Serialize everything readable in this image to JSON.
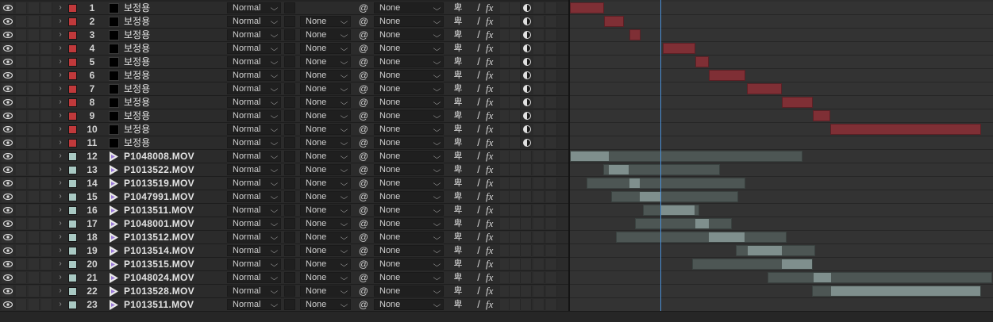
{
  "mode_chevron": "⌵",
  "colors": {
    "solid_label": "#c0393b",
    "video_label": "#a9c9c3",
    "solid_bar": "#7f2f35",
    "video_bar": "#4d5654",
    "video_bar_work": "#7f8f8d",
    "time_indicator": "#4a8fd6"
  },
  "icons": {
    "visibility": "eye-icon",
    "twirl": "chevron-right-icon",
    "parent_pick": "spiral-icon",
    "shy": "shy-icon",
    "quality": "slash-icon",
    "effects": "fx-icon",
    "adjustment": "adjustment-layer-icon",
    "footage": "footage-icon"
  },
  "layers": [
    {
      "index": "1",
      "name": "보정용",
      "kind": "solid",
      "mode": "Normal",
      "track_matte": "",
      "parent": "None",
      "quality": "/",
      "fx": "fx",
      "shy": "卑",
      "bar_start": 0.0,
      "bar_end": 0.08
    },
    {
      "index": "2",
      "name": "보정용",
      "kind": "solid",
      "mode": "Normal",
      "track_matte": "None",
      "parent": "None",
      "quality": "/",
      "fx": "fx",
      "shy": "卑",
      "bar_start": 0.08,
      "bar_end": 0.127
    },
    {
      "index": "3",
      "name": "보정용",
      "kind": "solid",
      "mode": "Normal",
      "track_matte": "None",
      "parent": "None",
      "quality": "/",
      "fx": "fx",
      "shy": "卑",
      "bar_start": 0.141,
      "bar_end": 0.167
    },
    {
      "index": "4",
      "name": "보정용",
      "kind": "solid",
      "mode": "Normal",
      "track_matte": "None",
      "parent": "None",
      "quality": "/",
      "fx": "fx",
      "shy": "卑",
      "bar_start": 0.22,
      "bar_end": 0.297
    },
    {
      "index": "5",
      "name": "보정용",
      "kind": "solid",
      "mode": "Normal",
      "track_matte": "None",
      "parent": "None",
      "quality": "/",
      "fx": "fx",
      "shy": "卑",
      "bar_start": 0.297,
      "bar_end": 0.329
    },
    {
      "index": "6",
      "name": "보정용",
      "kind": "solid",
      "mode": "Normal",
      "track_matte": "None",
      "parent": "None",
      "quality": "/",
      "fx": "fx",
      "shy": "卑",
      "bar_start": 0.329,
      "bar_end": 0.414
    },
    {
      "index": "7",
      "name": "보정용",
      "kind": "solid",
      "mode": "Normal",
      "track_matte": "None",
      "parent": "None",
      "quality": "/",
      "fx": "fx",
      "shy": "卑",
      "bar_start": 0.418,
      "bar_end": 0.501
    },
    {
      "index": "8",
      "name": "보정용",
      "kind": "solid",
      "mode": "Normal",
      "track_matte": "None",
      "parent": "None",
      "quality": "/",
      "fx": "fx",
      "shy": "卑",
      "bar_start": 0.501,
      "bar_end": 0.574
    },
    {
      "index": "9",
      "name": "보정용",
      "kind": "solid",
      "mode": "Normal",
      "track_matte": "None",
      "parent": "None",
      "quality": "/",
      "fx": "fx",
      "shy": "卑",
      "bar_start": 0.574,
      "bar_end": 0.616
    },
    {
      "index": "10",
      "name": "보정용",
      "kind": "solid",
      "mode": "Normal",
      "track_matte": "None",
      "parent": "None",
      "quality": "/",
      "fx": "fx",
      "shy": "卑",
      "bar_start": 0.616,
      "bar_end": 0.972
    },
    {
      "index": "11",
      "name": "보정용",
      "kind": "solid",
      "mode": "Normal",
      "track_matte": "None",
      "parent": "None",
      "quality": "/",
      "fx": "fx",
      "shy": "卑",
      "bar_start": null,
      "bar_end": null
    },
    {
      "index": "12",
      "name": "P1048008.MOV",
      "kind": "video",
      "mode": "Normal",
      "track_matte": "None",
      "parent": "None",
      "quality": "/",
      "fx": "fx",
      "shy": "卑",
      "bar_start": 0.0,
      "bar_end": 0.55,
      "work_start": 0.0,
      "work_end": 0.09
    },
    {
      "index": "13",
      "name": "P1013522.MOV",
      "kind": "video",
      "mode": "Normal",
      "track_matte": "None",
      "parent": "None",
      "quality": "/",
      "fx": "fx",
      "shy": "卑",
      "bar_start": 0.079,
      "bar_end": 0.355,
      "work_start": 0.09,
      "work_end": 0.137
    },
    {
      "index": "14",
      "name": "P1013519.MOV",
      "kind": "video",
      "mode": "Normal",
      "track_matte": "None",
      "parent": "None",
      "quality": "/",
      "fx": "fx",
      "shy": "卑",
      "bar_start": 0.04,
      "bar_end": 0.414,
      "work_start": 0.139,
      "work_end": 0.165
    },
    {
      "index": "15",
      "name": "P1047991.MOV",
      "kind": "video",
      "mode": "Normal",
      "track_matte": "None",
      "parent": "None",
      "quality": "/",
      "fx": "fx",
      "shy": "卑",
      "bar_start": 0.098,
      "bar_end": 0.398,
      "work_start": 0.165,
      "work_end": 0.214
    },
    {
      "index": "16",
      "name": "P1013511.MOV",
      "kind": "video",
      "mode": "Normal",
      "track_matte": "None",
      "parent": "None",
      "quality": "/",
      "fx": "fx",
      "shy": "卑",
      "bar_start": 0.173,
      "bar_end": 0.306,
      "work_start": 0.216,
      "work_end": 0.297
    },
    {
      "index": "17",
      "name": "P1048001.MOV",
      "kind": "video",
      "mode": "Normal",
      "track_matte": "None",
      "parent": "None",
      "quality": "/",
      "fx": "fx",
      "shy": "卑",
      "bar_start": 0.154,
      "bar_end": 0.383,
      "work_start": 0.297,
      "work_end": 0.329
    },
    {
      "index": "18",
      "name": "P1013512.MOV",
      "kind": "video",
      "mode": "Normal",
      "track_matte": "None",
      "parent": "None",
      "quality": "/",
      "fx": "fx",
      "shy": "卑",
      "bar_start": 0.109,
      "bar_end": 0.512,
      "work_start": 0.329,
      "work_end": 0.414
    },
    {
      "index": "19",
      "name": "P1013514.MOV",
      "kind": "video",
      "mode": "Normal",
      "track_matte": "None",
      "parent": "None",
      "quality": "/",
      "fx": "fx",
      "shy": "卑",
      "bar_start": 0.392,
      "bar_end": 0.58,
      "work_start": 0.418,
      "work_end": 0.501
    },
    {
      "index": "20",
      "name": "P1013515.MOV",
      "kind": "video",
      "mode": "Normal",
      "track_matte": "None",
      "parent": "None",
      "quality": "/",
      "fx": "fx",
      "shy": "卑",
      "bar_start": 0.289,
      "bar_end": 0.574,
      "work_start": 0.501,
      "work_end": 0.574
    },
    {
      "index": "21",
      "name": "P1048024.MOV",
      "kind": "video",
      "mode": "Normal",
      "track_matte": "None",
      "parent": "None",
      "quality": "/",
      "fx": "fx",
      "shy": "卑",
      "bar_start": 0.467,
      "bar_end": 0.998,
      "work_start": 0.574,
      "work_end": 0.616
    },
    {
      "index": "22",
      "name": "P1013528.MOV",
      "kind": "video",
      "mode": "Normal",
      "track_matte": "None",
      "parent": "None",
      "quality": "/",
      "fx": "fx",
      "shy": "卑",
      "bar_start": 0.572,
      "bar_end": 0.972,
      "work_start": 0.616,
      "work_end": 0.972
    },
    {
      "index": "23",
      "name": "P1013511.MOV",
      "kind": "video",
      "mode": "Normal",
      "track_matte": "None",
      "parent": "None",
      "quality": "/",
      "fx": "fx",
      "shy": "卑",
      "bar_start": null,
      "bar_end": null
    }
  ]
}
